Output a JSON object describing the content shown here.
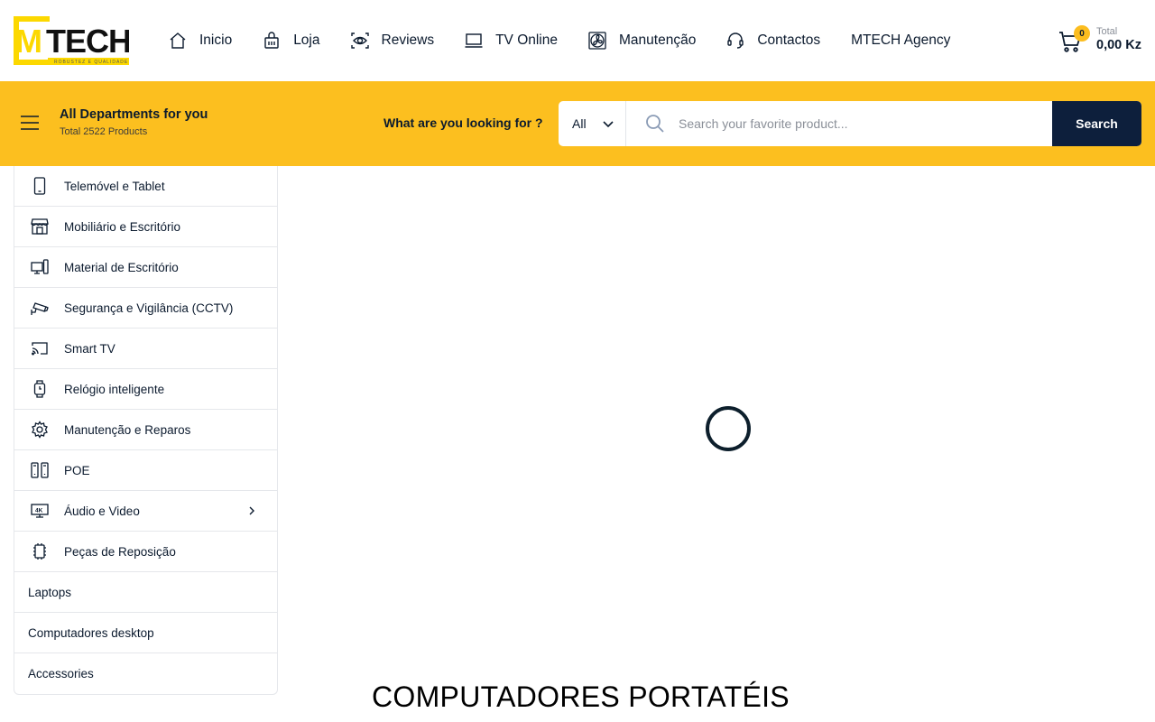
{
  "header": {
    "logo_text": "MTECH",
    "logo_tagline": "Robustez e Qualidade",
    "nav": [
      {
        "label": "Inicio",
        "icon": "home-icon"
      },
      {
        "label": "Loja",
        "icon": "shopping-bag-icon"
      },
      {
        "label": "Reviews",
        "icon": "eye-scan-icon"
      },
      {
        "label": "TV Online",
        "icon": "laptop-icon"
      },
      {
        "label": "Manutenção",
        "icon": "fan-icon"
      },
      {
        "label": "Contactos",
        "icon": "headset-icon"
      },
      {
        "label": "MTECH Agency",
        "icon": ""
      }
    ],
    "cart": {
      "count": "0",
      "total_label": "Total",
      "total_value": "0,00 Kz"
    }
  },
  "toolbar": {
    "departments_title": "All Departments for you",
    "departments_subtitle": "Total 2522 Products",
    "search_label": "What are you looking for ?",
    "category_value": "All",
    "search_placeholder": "Search your favorite product...",
    "search_button": "Search"
  },
  "sidebar": {
    "items": [
      {
        "label": "Telemóvel e Tablet",
        "icon": "smartphone-icon"
      },
      {
        "label": "Mobiliário e Escritório",
        "icon": "storefront-icon"
      },
      {
        "label": "Material de Escritório",
        "icon": "devices-icon"
      },
      {
        "label": "Segurança e Vigilância (CCTV)",
        "icon": "cctv-camera-icon"
      },
      {
        "label": "Smart TV",
        "icon": "cast-icon"
      },
      {
        "label": "Relógio inteligente",
        "icon": "smartwatch-icon"
      },
      {
        "label": "Manutenção e Reparos",
        "icon": "gear-icon"
      },
      {
        "label": "POE",
        "icon": "network-devices-icon"
      },
      {
        "label": "Áudio e Video",
        "icon": "monitor-4k-icon",
        "has_submenu": true
      },
      {
        "label": "Peças de Reposição",
        "icon": "chip-icon"
      },
      {
        "label": "Laptops",
        "icon": ""
      },
      {
        "label": "Computadores desktop",
        "icon": ""
      },
      {
        "label": "Accessories",
        "icon": ""
      }
    ]
  },
  "main": {
    "heading": "COMPUTADORES PORTATÉIS"
  },
  "colors": {
    "accent_yellow": "#fcbf1f",
    "navy": "#0d1f3c"
  }
}
